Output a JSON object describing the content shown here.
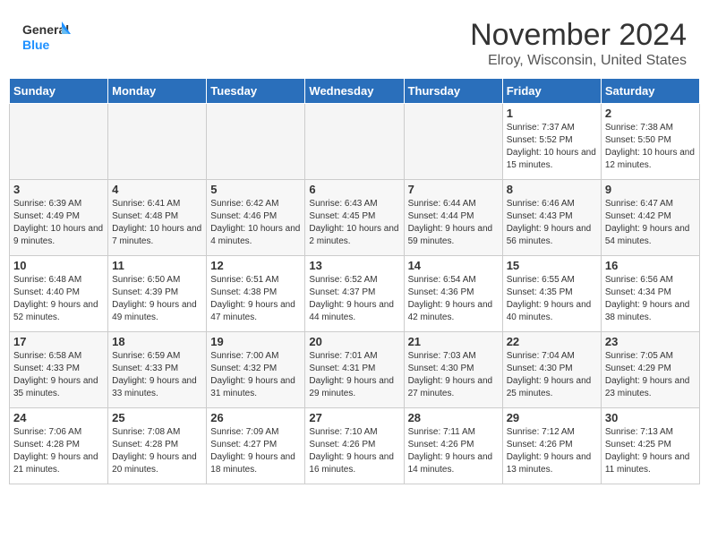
{
  "header": {
    "logo_line1": "General",
    "logo_line2": "Blue",
    "month_title": "November 2024",
    "location": "Elroy, Wisconsin, United States"
  },
  "days_of_week": [
    "Sunday",
    "Monday",
    "Tuesday",
    "Wednesday",
    "Thursday",
    "Friday",
    "Saturday"
  ],
  "weeks": [
    [
      {
        "day": "",
        "info": ""
      },
      {
        "day": "",
        "info": ""
      },
      {
        "day": "",
        "info": ""
      },
      {
        "day": "",
        "info": ""
      },
      {
        "day": "",
        "info": ""
      },
      {
        "day": "1",
        "info": "Sunrise: 7:37 AM\nSunset: 5:52 PM\nDaylight: 10 hours and 15 minutes."
      },
      {
        "day": "2",
        "info": "Sunrise: 7:38 AM\nSunset: 5:50 PM\nDaylight: 10 hours and 12 minutes."
      }
    ],
    [
      {
        "day": "3",
        "info": "Sunrise: 6:39 AM\nSunset: 4:49 PM\nDaylight: 10 hours and 9 minutes."
      },
      {
        "day": "4",
        "info": "Sunrise: 6:41 AM\nSunset: 4:48 PM\nDaylight: 10 hours and 7 minutes."
      },
      {
        "day": "5",
        "info": "Sunrise: 6:42 AM\nSunset: 4:46 PM\nDaylight: 10 hours and 4 minutes."
      },
      {
        "day": "6",
        "info": "Sunrise: 6:43 AM\nSunset: 4:45 PM\nDaylight: 10 hours and 2 minutes."
      },
      {
        "day": "7",
        "info": "Sunrise: 6:44 AM\nSunset: 4:44 PM\nDaylight: 9 hours and 59 minutes."
      },
      {
        "day": "8",
        "info": "Sunrise: 6:46 AM\nSunset: 4:43 PM\nDaylight: 9 hours and 56 minutes."
      },
      {
        "day": "9",
        "info": "Sunrise: 6:47 AM\nSunset: 4:42 PM\nDaylight: 9 hours and 54 minutes."
      }
    ],
    [
      {
        "day": "10",
        "info": "Sunrise: 6:48 AM\nSunset: 4:40 PM\nDaylight: 9 hours and 52 minutes."
      },
      {
        "day": "11",
        "info": "Sunrise: 6:50 AM\nSunset: 4:39 PM\nDaylight: 9 hours and 49 minutes."
      },
      {
        "day": "12",
        "info": "Sunrise: 6:51 AM\nSunset: 4:38 PM\nDaylight: 9 hours and 47 minutes."
      },
      {
        "day": "13",
        "info": "Sunrise: 6:52 AM\nSunset: 4:37 PM\nDaylight: 9 hours and 44 minutes."
      },
      {
        "day": "14",
        "info": "Sunrise: 6:54 AM\nSunset: 4:36 PM\nDaylight: 9 hours and 42 minutes."
      },
      {
        "day": "15",
        "info": "Sunrise: 6:55 AM\nSunset: 4:35 PM\nDaylight: 9 hours and 40 minutes."
      },
      {
        "day": "16",
        "info": "Sunrise: 6:56 AM\nSunset: 4:34 PM\nDaylight: 9 hours and 38 minutes."
      }
    ],
    [
      {
        "day": "17",
        "info": "Sunrise: 6:58 AM\nSunset: 4:33 PM\nDaylight: 9 hours and 35 minutes."
      },
      {
        "day": "18",
        "info": "Sunrise: 6:59 AM\nSunset: 4:33 PM\nDaylight: 9 hours and 33 minutes."
      },
      {
        "day": "19",
        "info": "Sunrise: 7:00 AM\nSunset: 4:32 PM\nDaylight: 9 hours and 31 minutes."
      },
      {
        "day": "20",
        "info": "Sunrise: 7:01 AM\nSunset: 4:31 PM\nDaylight: 9 hours and 29 minutes."
      },
      {
        "day": "21",
        "info": "Sunrise: 7:03 AM\nSunset: 4:30 PM\nDaylight: 9 hours and 27 minutes."
      },
      {
        "day": "22",
        "info": "Sunrise: 7:04 AM\nSunset: 4:30 PM\nDaylight: 9 hours and 25 minutes."
      },
      {
        "day": "23",
        "info": "Sunrise: 7:05 AM\nSunset: 4:29 PM\nDaylight: 9 hours and 23 minutes."
      }
    ],
    [
      {
        "day": "24",
        "info": "Sunrise: 7:06 AM\nSunset: 4:28 PM\nDaylight: 9 hours and 21 minutes."
      },
      {
        "day": "25",
        "info": "Sunrise: 7:08 AM\nSunset: 4:28 PM\nDaylight: 9 hours and 20 minutes."
      },
      {
        "day": "26",
        "info": "Sunrise: 7:09 AM\nSunset: 4:27 PM\nDaylight: 9 hours and 18 minutes."
      },
      {
        "day": "27",
        "info": "Sunrise: 7:10 AM\nSunset: 4:26 PM\nDaylight: 9 hours and 16 minutes."
      },
      {
        "day": "28",
        "info": "Sunrise: 7:11 AM\nSunset: 4:26 PM\nDaylight: 9 hours and 14 minutes."
      },
      {
        "day": "29",
        "info": "Sunrise: 7:12 AM\nSunset: 4:26 PM\nDaylight: 9 hours and 13 minutes."
      },
      {
        "day": "30",
        "info": "Sunrise: 7:13 AM\nSunset: 4:25 PM\nDaylight: 9 hours and 11 minutes."
      }
    ]
  ]
}
